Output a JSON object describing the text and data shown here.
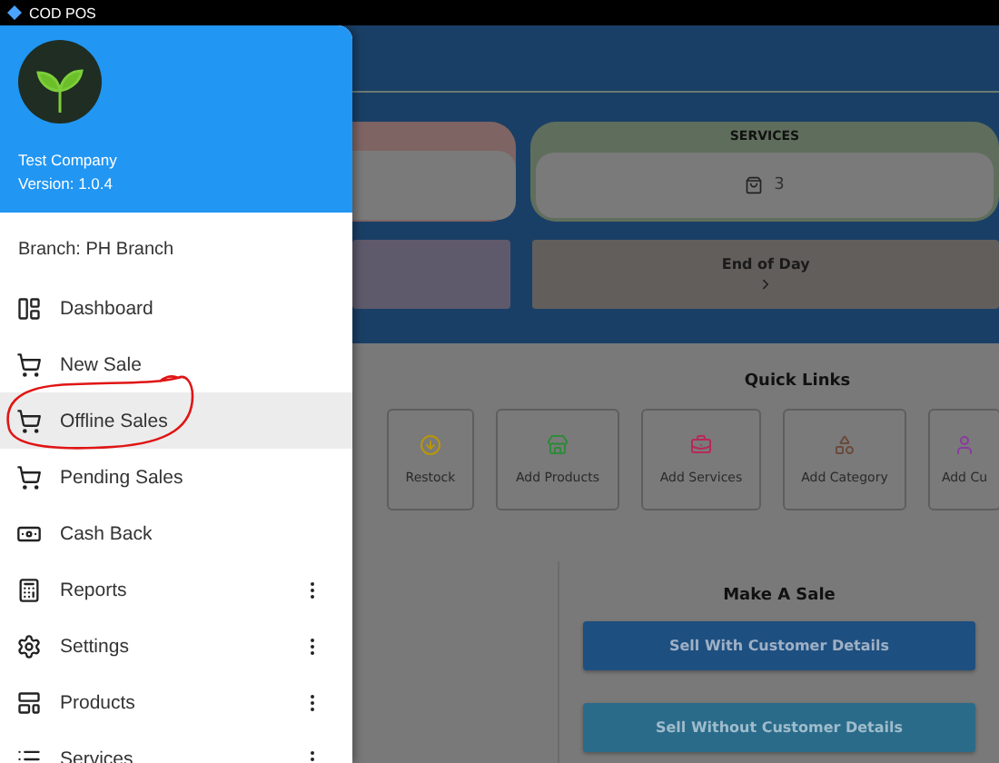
{
  "title_bar": {
    "title": "COD POS"
  },
  "drawer": {
    "company": "Test Company",
    "version": "Version: 1.0.4",
    "branch": "Branch: PH Branch",
    "items": [
      {
        "label": "Dashboard",
        "selected": false,
        "has_menu": false
      },
      {
        "label": "New Sale",
        "selected": false,
        "has_menu": false
      },
      {
        "label": "Offline Sales",
        "selected": true,
        "has_menu": false
      },
      {
        "label": "Pending Sales",
        "selected": false,
        "has_menu": false
      },
      {
        "label": "Cash Back",
        "selected": false,
        "has_menu": false
      },
      {
        "label": "Reports",
        "selected": false,
        "has_menu": true
      },
      {
        "label": "Settings",
        "selected": false,
        "has_menu": true
      },
      {
        "label": "Products",
        "selected": false,
        "has_menu": true
      },
      {
        "label": "Services",
        "selected": false,
        "has_menu": true
      }
    ]
  },
  "summary": {
    "services_card": {
      "title": "SERVICES",
      "count": "3"
    },
    "end_of_day": {
      "label": "End of Day"
    }
  },
  "quick_links": {
    "title": "Quick Links",
    "links": [
      {
        "label": "Restock",
        "color": "#b8960a"
      },
      {
        "label": "Add Products",
        "color": "#2e8a3a"
      },
      {
        "label": "Add Services",
        "color": "#b8285a"
      },
      {
        "label": "Add Category",
        "color": "#6a4a3a"
      },
      {
        "label": "Add Cu",
        "color": "#8a3aa0"
      }
    ]
  },
  "make_a_sale": {
    "title": "Make A Sale",
    "buttons": [
      {
        "label": "Sell With Customer Details",
        "kind": "primary"
      },
      {
        "label": "Sell Without Customer Details",
        "kind": "secondary"
      }
    ]
  }
}
